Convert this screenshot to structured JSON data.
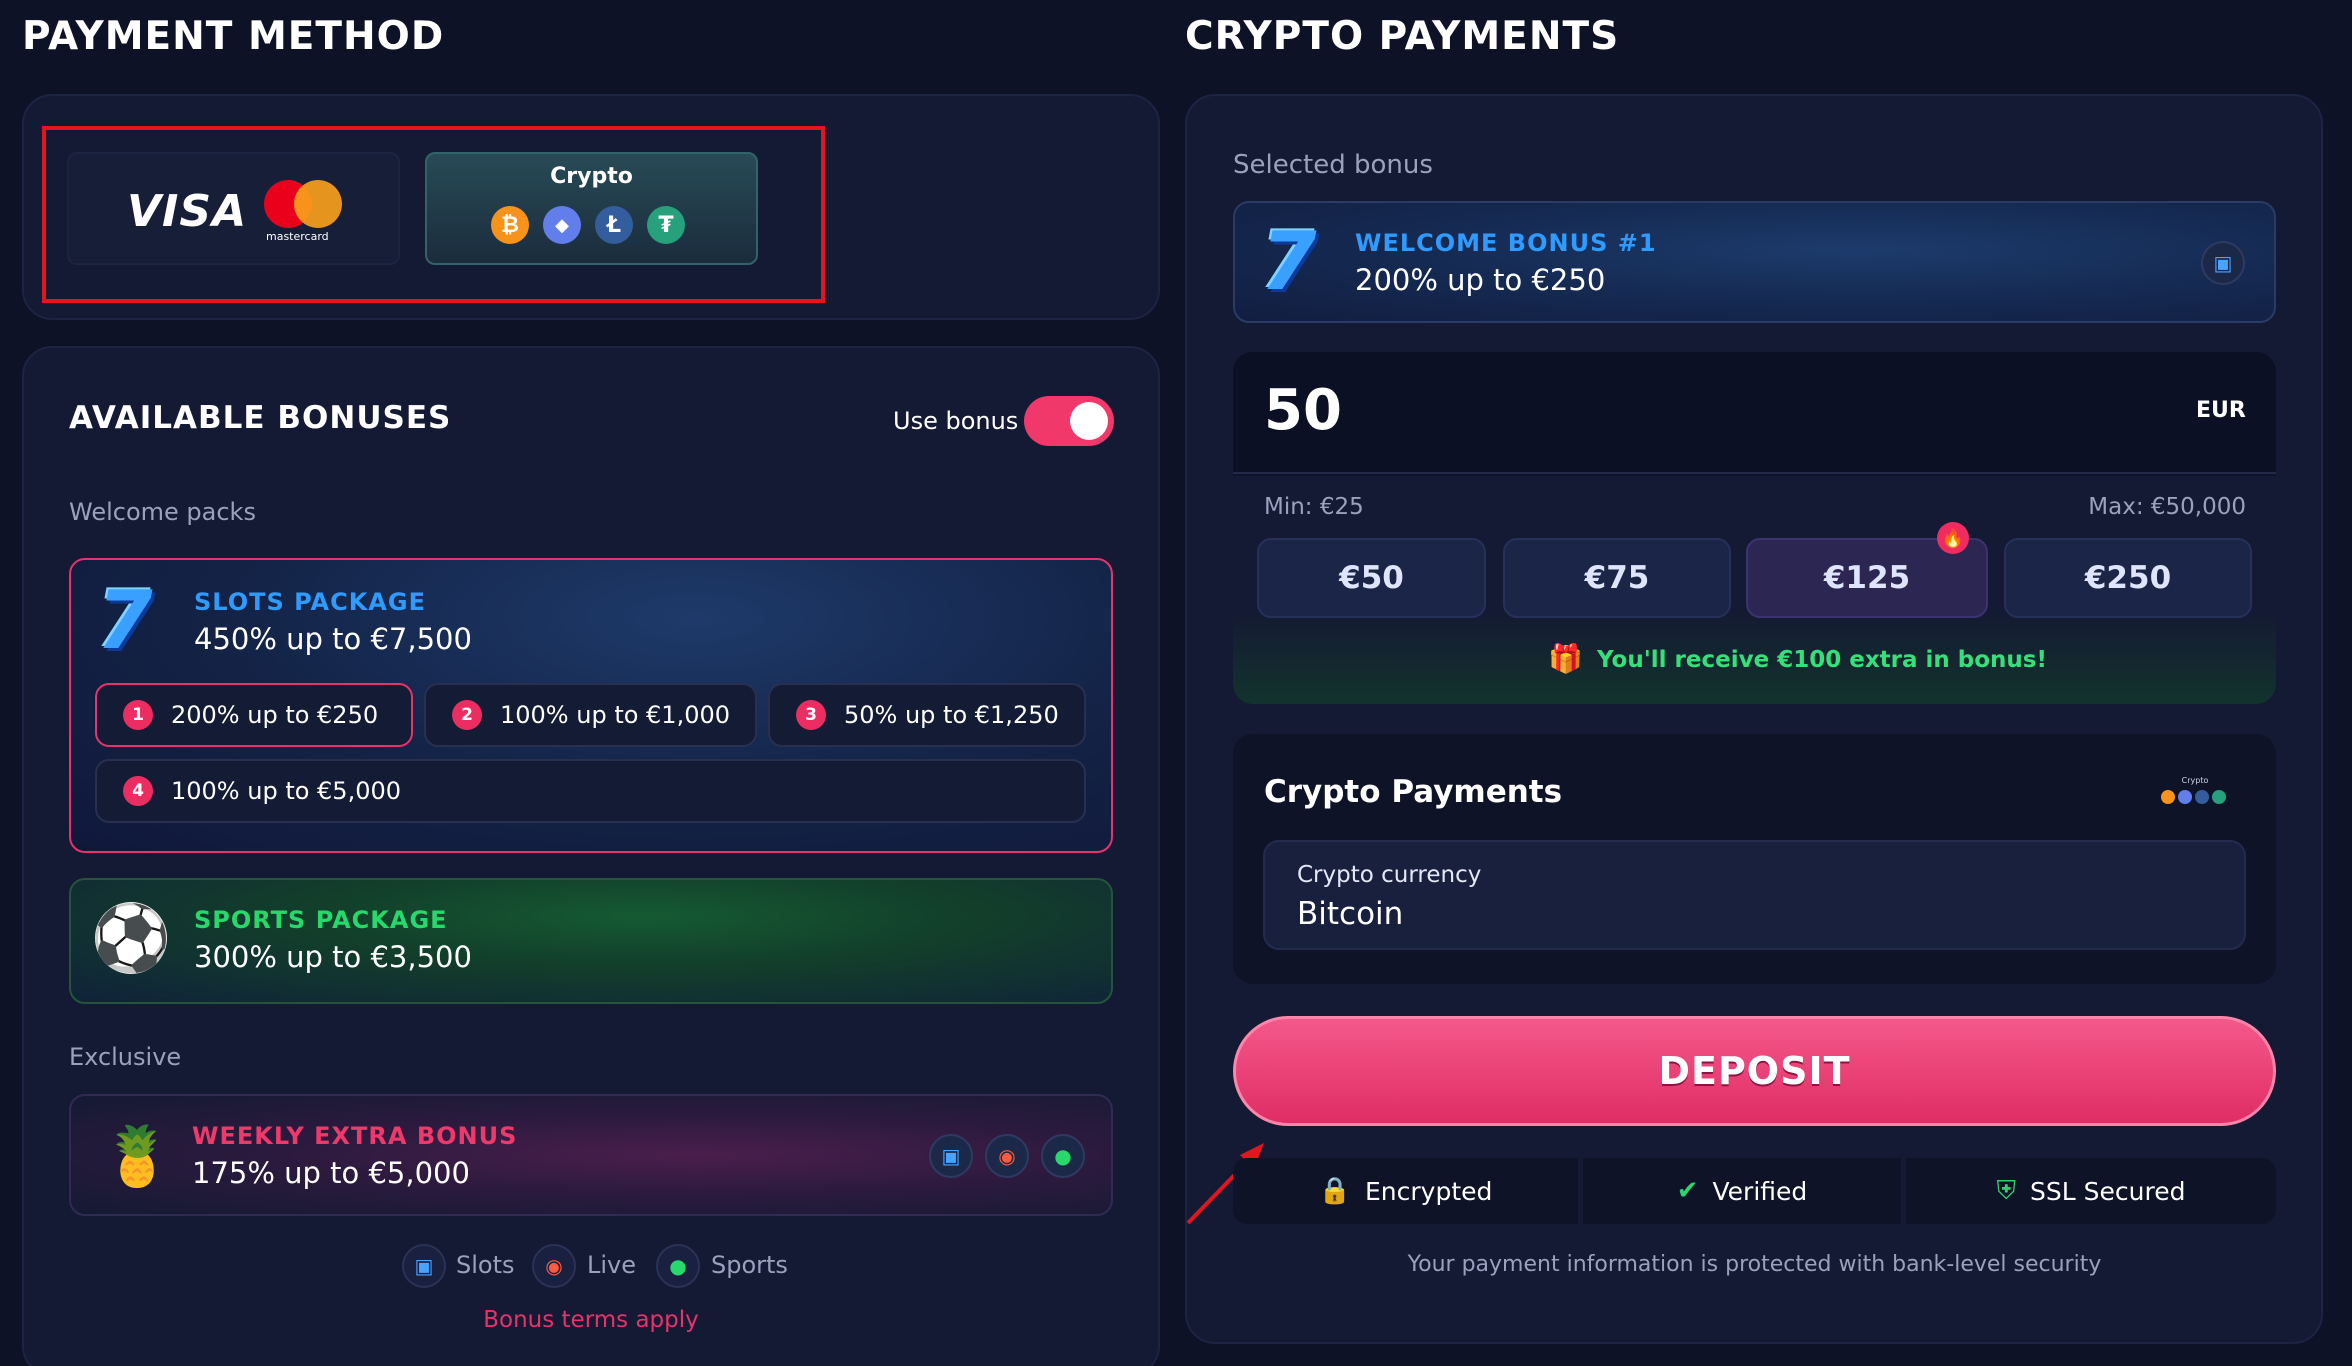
{
  "payment_method": {
    "heading": "PAYMENT METHOD",
    "visa_label": "VISA",
    "mastercard_label": "mastercard",
    "crypto_label": "Crypto",
    "coins": [
      "₿",
      "◆",
      "Ł",
      "₮"
    ]
  },
  "crypto_payments_heading": "CRYPTO PAYMENTS",
  "bonuses": {
    "heading": "AVAILABLE BONUSES",
    "use_bonus_label": "Use bonus",
    "welcome_packs_label": "Welcome packs",
    "exclusive_label": "Exclusive",
    "slots": {
      "icon": "7",
      "title": "SLOTS PACKAGE",
      "subtitle": "450% up to €7,500",
      "tiers": [
        {
          "num": "1",
          "label": "200% up to €250"
        },
        {
          "num": "2",
          "label": "100% up to €1,000"
        },
        {
          "num": "3",
          "label": "50% up to €1,250"
        },
        {
          "num": "4",
          "label": "100% up to €5,000"
        }
      ]
    },
    "sports": {
      "icon": "⚽",
      "title": "SPORTS PACKAGE",
      "subtitle": "300% up to €3,500"
    },
    "weekly": {
      "icon": "🍍",
      "title": "WEEKLY EXTRA BONUS",
      "subtitle": "175% up to €5,000"
    },
    "footer": {
      "slots_label": "Slots",
      "live_label": "Live",
      "sports_label": "Sports",
      "terms": "Bonus terms apply"
    }
  },
  "selected_bonus": {
    "label": "Selected bonus",
    "icon": "7",
    "title": "WELCOME BONUS #1",
    "subtitle": "200% up to €250"
  },
  "amount": {
    "value": "50",
    "currency": "EUR",
    "min": "Min: €25",
    "max": "Max: €50,000",
    "options": [
      "€50",
      "€75",
      "€125",
      "€250"
    ],
    "extra_text": "You'll receive €100 extra in bonus!"
  },
  "crypto_section": {
    "title": "Crypto Payments",
    "field_label": "Crypto currency",
    "field_value": "Bitcoin",
    "logo_label": "Crypto"
  },
  "deposit_label": "DEPOSIT",
  "trust": {
    "encrypted": "Encrypted",
    "verified": "Verified",
    "ssl": "SSL Secured",
    "note": "Your payment information is protected with bank-level security"
  },
  "colors": {
    "accent_pink": "#f0386b",
    "slots_title": "#2f9bff",
    "sports_title": "#27d86b",
    "weekly_title": "#f0386b",
    "extra_text": "#35e07a",
    "annotation_red": "#e5141f"
  }
}
